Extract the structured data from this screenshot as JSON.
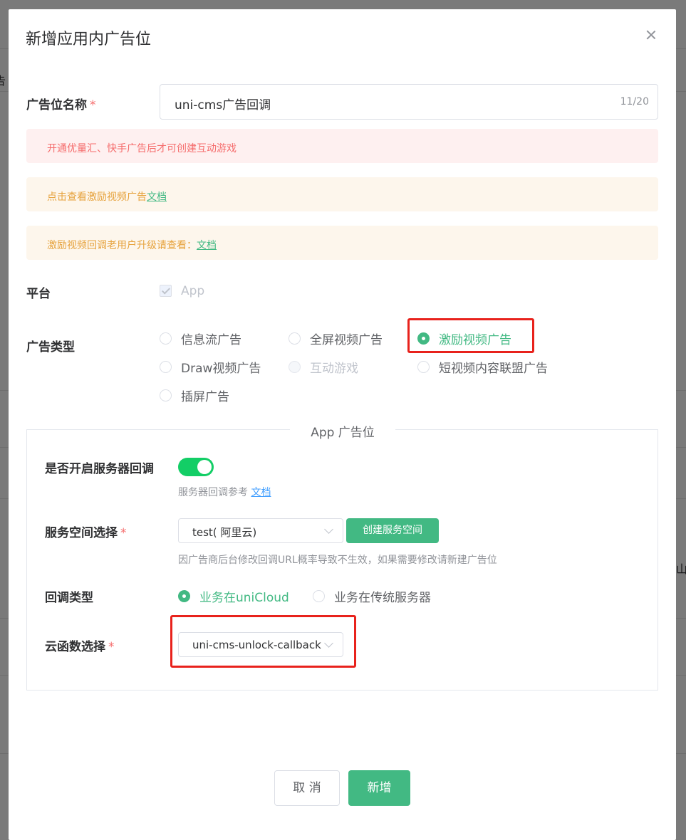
{
  "background": {
    "peek_left": "告",
    "peek_right": "山"
  },
  "dialog": {
    "title": "新增应用内广告位",
    "close_icon": "close-icon"
  },
  "form": {
    "name": {
      "label": "广告位名称",
      "required": "*",
      "value": "uni-cms广告回调",
      "counter": "11/20"
    },
    "alerts": {
      "error_text": "开通优量汇、快手广告后才可创建互动游戏",
      "info1_text": "点击查看激励视频广告",
      "info1_link": "文档",
      "info2_text": "激励视频回调老用户升级请查看：",
      "info2_link": "文档"
    },
    "platform": {
      "label": "平台",
      "option": "App",
      "checked": true
    },
    "ad_type": {
      "label": "广告类型",
      "options": [
        "信息流广告",
        "全屏视频广告",
        "激励视频广告",
        "Draw视频广告",
        "互动游戏",
        "短视频内容联盟广告",
        "插屏广告"
      ],
      "selected": "激励视频广告",
      "disabled": "互动游戏"
    }
  },
  "app_section": {
    "legend": "App 广告位",
    "server_callback": {
      "label": "是否开启服务器回调",
      "enabled": true,
      "hint": "服务器回调参考",
      "hint_link": "文档"
    },
    "service_space": {
      "label": "服务空间选择",
      "required": "*",
      "value": "test( 阿里云)",
      "create_button": "创建服务空间",
      "hint": "因广告商后台修改回调URL概率导致不生效，如果需要修改请新建广告位"
    },
    "callback_type": {
      "label": "回调类型",
      "options": [
        "业务在uniCloud",
        "业务在传统服务器"
      ],
      "selected": "业务在uniCloud"
    },
    "cloud_function": {
      "label": "云函数选择",
      "required": "*",
      "value": "uni-cms-unlock-callback"
    }
  },
  "footer": {
    "cancel": "取 消",
    "submit": "新增"
  },
  "colors": {
    "accent": "#42b983",
    "highlight": "#e8221c",
    "switch_on": "#13ce66"
  }
}
